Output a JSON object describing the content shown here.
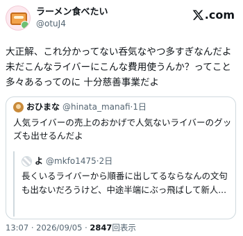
{
  "author": {
    "display_name": "ラーメン食べたい",
    "handle": "@otuJ4"
  },
  "brand": {
    "logo_text": ".com",
    "icon": "x-logo-icon"
  },
  "tweet": {
    "lines": [
      "大正解、これ分かってない呑気なやつ多すぎなんだよ",
      "未だこんなライバーにこんな費用使うんか？ってこと",
      "多々あるってのに 十分慈善事業だよ"
    ]
  },
  "quote": {
    "name": "おひまな",
    "handle": "@hinata_manafi",
    "separator": "·",
    "time": "1日",
    "lines": [
      "人気ライバーの売上のおかげで人気ないライバーのグッ",
      "ズも出せるんだよ"
    ],
    "nested": {
      "name": "よ",
      "handle": "@mkfo1475",
      "separator": "·",
      "time": "2日",
      "lines": [
        "長くいるライバーから順番に出してるならなんの文句",
        "も出ないだろうけど、中途半端にぶっ飛ばして新人..."
      ]
    }
  },
  "footer": {
    "time": "13:07",
    "dot": "·",
    "date": "2026/09/05",
    "views_count": "2847",
    "views_label": "回表示"
  }
}
